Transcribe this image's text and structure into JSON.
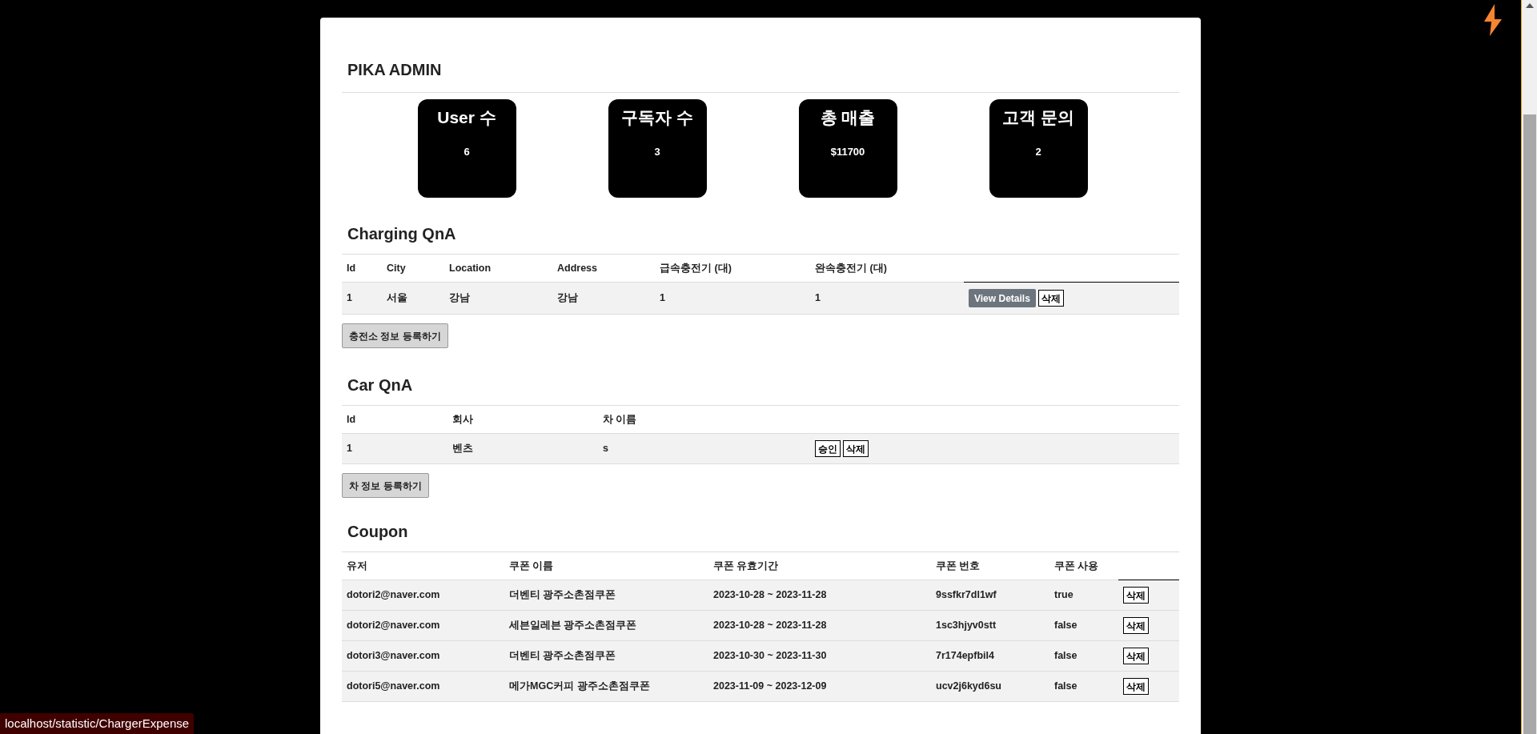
{
  "header": {
    "title": "PIKA ADMIN"
  },
  "stats": [
    {
      "label": "User 수",
      "value": "6"
    },
    {
      "label": "구독자 수",
      "value": "3"
    },
    {
      "label": "총 매출",
      "value": "$11700"
    },
    {
      "label": "고객 문의",
      "value": "2"
    }
  ],
  "sections": [
    {
      "title": "Charging QnA",
      "columns": [
        "Id",
        "City",
        "Location",
        "Address",
        "급속충전기 (대)",
        "완속충전기 (대)"
      ],
      "rows": [
        {
          "cells": [
            "1",
            "서울",
            "강남",
            "강남",
            "1",
            "1"
          ],
          "actions": [
            {
              "label": "View Details",
              "kind": "primary"
            },
            {
              "label": "삭제",
              "kind": "outline"
            }
          ]
        }
      ],
      "add_button": "충전소 정보 등록하기"
    },
    {
      "title": "Car QnA",
      "columns": [
        "Id",
        "회사",
        "차 이름"
      ],
      "rows": [
        {
          "cells": [
            "1",
            "벤츠",
            "s"
          ],
          "actions": [
            {
              "label": "승인",
              "kind": "outline"
            },
            {
              "label": "삭제",
              "kind": "outline"
            }
          ]
        }
      ],
      "add_button": "차 정보 등록하기"
    },
    {
      "title": "Coupon",
      "columns": [
        "유저",
        "쿠폰 이름",
        "쿠폰 유효기간",
        "쿠폰 번호",
        "쿠폰 사용"
      ],
      "rows": [
        {
          "cells": [
            "dotori2@naver.com",
            "더벤티 광주소촌점쿠폰",
            "2023-10-28 ~ 2023-11-28",
            "9ssfkr7dl1wf",
            "true"
          ],
          "actions": [
            {
              "label": "삭제",
              "kind": "outline"
            }
          ]
        },
        {
          "cells": [
            "dotori2@naver.com",
            "세븐일레븐 광주소촌점쿠폰",
            "2023-10-28 ~ 2023-11-28",
            "1sc3hjyv0stt",
            "false"
          ],
          "actions": [
            {
              "label": "삭제",
              "kind": "outline"
            }
          ]
        },
        {
          "cells": [
            "dotori3@naver.com",
            "더벤티 광주소촌점쿠폰",
            "2023-10-30 ~ 2023-11-30",
            "7r174epfbil4",
            "false"
          ],
          "actions": [
            {
              "label": "삭제",
              "kind": "outline"
            }
          ]
        },
        {
          "cells": [
            "dotori5@naver.com",
            "메가MGC커피 광주소촌점쿠폰",
            "2023-11-09 ~ 2023-12-09",
            "ucv2j6kyd6su",
            "false"
          ],
          "actions": [
            {
              "label": "삭제",
              "kind": "outline"
            }
          ]
        }
      ]
    }
  ],
  "status_bar": {
    "url": "localhost/statistic/ChargerExpense"
  }
}
